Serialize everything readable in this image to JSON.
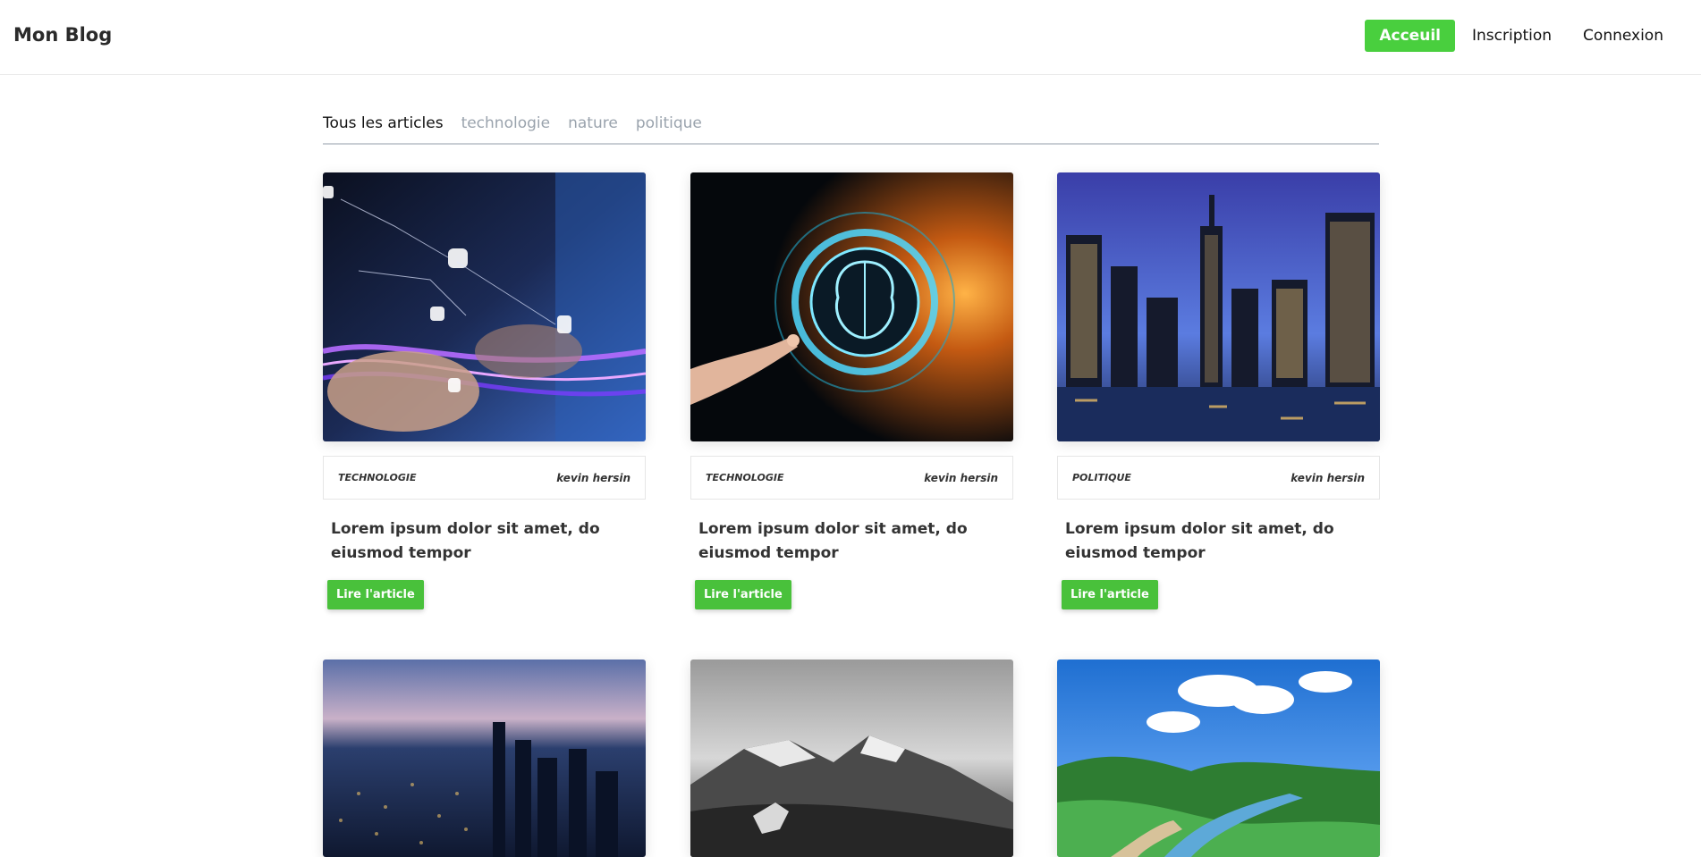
{
  "header": {
    "brand": "Mon Blog",
    "nav": [
      {
        "label": "Acceuil",
        "active": true
      },
      {
        "label": "Inscription",
        "active": false
      },
      {
        "label": "Connexion",
        "active": false
      }
    ]
  },
  "filters": {
    "tabs": [
      "Tous les articles",
      "technologie",
      "nature",
      "politique"
    ],
    "active": "Tous les articles"
  },
  "articles": [
    {
      "category": "TECHNOLOGIE",
      "author": "kevin hersin",
      "title": "Lorem ipsum dolor sit amet, do eiusmod tempor",
      "cta": "Lire l'article",
      "image": "cybersecurity-laptop-image"
    },
    {
      "category": "TECHNOLOGIE",
      "author": "kevin hersin",
      "title": "Lorem ipsum dolor sit amet, do eiusmod tempor",
      "cta": "Lire l'article",
      "image": "ai-brain-image"
    },
    {
      "category": "POLITIQUE",
      "author": "kevin hersin",
      "title": "Lorem ipsum dolor sit amet, do eiusmod tempor",
      "cta": "Lire l'article",
      "image": "city-skyline-night-image"
    },
    {
      "image": "city-aerial-image"
    },
    {
      "image": "mountain-wolf-image"
    },
    {
      "image": "river-valley-image"
    }
  ],
  "colors": {
    "accent": "#49cf3e",
    "button": "#49c13b",
    "tab_inactive": "#9aa3ad"
  }
}
